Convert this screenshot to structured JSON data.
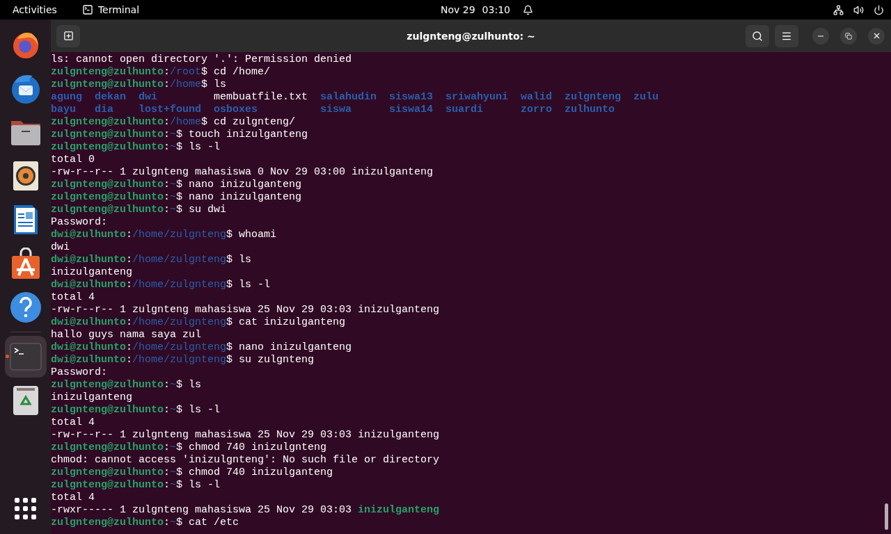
{
  "top_bar": {
    "activities": "Activities",
    "app": {
      "label": "Terminal"
    },
    "date": "Nov 29",
    "time": "03:10"
  },
  "dock": {
    "items": [
      {
        "kind": "browser",
        "selected": false,
        "running": false
      },
      {
        "kind": "mail",
        "selected": false,
        "running": false
      },
      {
        "kind": "folder",
        "selected": false,
        "running": false
      },
      {
        "kind": "speaker",
        "selected": false,
        "running": false
      },
      {
        "kind": "document",
        "selected": false,
        "running": false
      },
      {
        "kind": "store",
        "selected": false,
        "running": false
      },
      {
        "kind": "help",
        "selected": false,
        "running": false
      },
      {
        "kind": "terminal",
        "selected": true,
        "running": true
      },
      {
        "kind": "trash",
        "selected": false,
        "running": false
      }
    ]
  },
  "window": {
    "title": "zulgnteng@zulhunto: ~"
  },
  "terminal": {
    "lines": [
      [
        {
          "kind": "plain",
          "text": "ls: cannot open directory '.': Permission denied"
        }
      ],
      [
        {
          "kind": "user",
          "text": "zulgnteng@zulhunto"
        },
        {
          "kind": "plain",
          "text": ":"
        },
        {
          "kind": "path",
          "text": "/root"
        },
        {
          "kind": "plain",
          "text": "$ cd /home/"
        }
      ],
      [
        {
          "kind": "user",
          "text": "zulgnteng@zulhunto"
        },
        {
          "kind": "plain",
          "text": ":"
        },
        {
          "kind": "path",
          "text": "/home"
        },
        {
          "kind": "plain",
          "text": "$ ls"
        }
      ],
      {
        "kind": "listing",
        "rows": [
          [
            {
              "kind": "dir",
              "text": "agung"
            },
            {
              "kind": "dir",
              "text": "dekan"
            },
            {
              "kind": "dir",
              "text": "dwi"
            },
            {
              "kind": "plain",
              "text": "membuatfile.txt"
            },
            {
              "kind": "dir",
              "text": "salahudin"
            },
            {
              "kind": "dir",
              "text": "siswa13"
            },
            {
              "kind": "dir",
              "text": "sriwahyuni"
            },
            {
              "kind": "dir",
              "text": "walid"
            },
            {
              "kind": "dir",
              "text": "zulgnteng"
            },
            {
              "kind": "dir",
              "text": "zulu"
            }
          ],
          [
            {
              "kind": "dir",
              "text": "bayu"
            },
            {
              "kind": "dir",
              "text": "dia"
            },
            {
              "kind": "dir",
              "text": "lost+found"
            },
            {
              "kind": "dir",
              "text": "osboxes"
            },
            {
              "kind": "dir",
              "text": "siswa"
            },
            {
              "kind": "dir",
              "text": "siswa14"
            },
            {
              "kind": "dir",
              "text": "suardi"
            },
            {
              "kind": "dir",
              "text": "zorro"
            },
            {
              "kind": "dir",
              "text": "zulhunto"
            }
          ]
        ]
      },
      [
        {
          "kind": "user",
          "text": "zulgnteng@zulhunto"
        },
        {
          "kind": "plain",
          "text": ":"
        },
        {
          "kind": "path",
          "text": "/home"
        },
        {
          "kind": "plain",
          "text": "$ cd zulgnteng/"
        }
      ],
      [
        {
          "kind": "user",
          "text": "zulgnteng@zulhunto"
        },
        {
          "kind": "plain",
          "text": ":"
        },
        {
          "kind": "path",
          "text": "~"
        },
        {
          "kind": "plain",
          "text": "$ touch inizulganteng"
        }
      ],
      [
        {
          "kind": "user",
          "text": "zulgnteng@zulhunto"
        },
        {
          "kind": "plain",
          "text": ":"
        },
        {
          "kind": "path",
          "text": "~"
        },
        {
          "kind": "plain",
          "text": "$ ls -l"
        }
      ],
      [
        {
          "kind": "plain",
          "text": "total 0"
        }
      ],
      [
        {
          "kind": "plain",
          "text": "-rw-r--r-- 1 zulgnteng mahasiswa 0 Nov 29 03:00 inizulganteng"
        }
      ],
      [
        {
          "kind": "user",
          "text": "zulgnteng@zulhunto"
        },
        {
          "kind": "plain",
          "text": ":"
        },
        {
          "kind": "path",
          "text": "~"
        },
        {
          "kind": "plain",
          "text": "$ nano inizulganteng"
        }
      ],
      [
        {
          "kind": "user",
          "text": "zulgnteng@zulhunto"
        },
        {
          "kind": "plain",
          "text": ":"
        },
        {
          "kind": "path",
          "text": "~"
        },
        {
          "kind": "plain",
          "text": "$ nano inizulganteng"
        }
      ],
      [
        {
          "kind": "user",
          "text": "zulgnteng@zulhunto"
        },
        {
          "kind": "plain",
          "text": ":"
        },
        {
          "kind": "path",
          "text": "~"
        },
        {
          "kind": "plain",
          "text": "$ su dwi"
        }
      ],
      [
        {
          "kind": "plain",
          "text": "Password:"
        }
      ],
      [
        {
          "kind": "user",
          "text": "dwi@zulhunto"
        },
        {
          "kind": "plain",
          "text": ":"
        },
        {
          "kind": "path",
          "text": "/home/zulgnteng"
        },
        {
          "kind": "plain",
          "text": "$ whoami"
        }
      ],
      [
        {
          "kind": "plain",
          "text": "dwi"
        }
      ],
      [
        {
          "kind": "user",
          "text": "dwi@zulhunto"
        },
        {
          "kind": "plain",
          "text": ":"
        },
        {
          "kind": "path",
          "text": "/home/zulgnteng"
        },
        {
          "kind": "plain",
          "text": "$ ls"
        }
      ],
      [
        {
          "kind": "plain",
          "text": "inizulganteng"
        }
      ],
      [
        {
          "kind": "user",
          "text": "dwi@zulhunto"
        },
        {
          "kind": "plain",
          "text": ":"
        },
        {
          "kind": "path",
          "text": "/home/zulgnteng"
        },
        {
          "kind": "plain",
          "text": "$ ls -l"
        }
      ],
      [
        {
          "kind": "plain",
          "text": "total 4"
        }
      ],
      [
        {
          "kind": "plain",
          "text": "-rw-r--r-- 1 zulgnteng mahasiswa 25 Nov 29 03:03 inizulganteng"
        }
      ],
      [
        {
          "kind": "user",
          "text": "dwi@zulhunto"
        },
        {
          "kind": "plain",
          "text": ":"
        },
        {
          "kind": "path",
          "text": "/home/zulgnteng"
        },
        {
          "kind": "plain",
          "text": "$ cat inizulganteng"
        }
      ],
      [
        {
          "kind": "plain",
          "text": "hallo guys nama saya zul"
        }
      ],
      [
        {
          "kind": "user",
          "text": "dwi@zulhunto"
        },
        {
          "kind": "plain",
          "text": ":"
        },
        {
          "kind": "path",
          "text": "/home/zulgnteng"
        },
        {
          "kind": "plain",
          "text": "$ nano inizulganteng"
        }
      ],
      [
        {
          "kind": "user",
          "text": "dwi@zulhunto"
        },
        {
          "kind": "plain",
          "text": ":"
        },
        {
          "kind": "path",
          "text": "/home/zulgnteng"
        },
        {
          "kind": "plain",
          "text": "$ su zulgnteng"
        }
      ],
      [
        {
          "kind": "plain",
          "text": "Password:"
        }
      ],
      [
        {
          "kind": "user",
          "text": "zulgnteng@zulhunto"
        },
        {
          "kind": "plain",
          "text": ":"
        },
        {
          "kind": "path",
          "text": "~"
        },
        {
          "kind": "plain",
          "text": "$ ls"
        }
      ],
      [
        {
          "kind": "plain",
          "text": "inizulganteng"
        }
      ],
      [
        {
          "kind": "user",
          "text": "zulgnteng@zulhunto"
        },
        {
          "kind": "plain",
          "text": ":"
        },
        {
          "kind": "path",
          "text": "~"
        },
        {
          "kind": "plain",
          "text": "$ ls -l"
        }
      ],
      [
        {
          "kind": "plain",
          "text": "total 4"
        }
      ],
      [
        {
          "kind": "plain",
          "text": "-rw-r--r-- 1 zulgnteng mahasiswa 25 Nov 29 03:03 inizulganteng"
        }
      ],
      [
        {
          "kind": "user",
          "text": "zulgnteng@zulhunto"
        },
        {
          "kind": "plain",
          "text": ":"
        },
        {
          "kind": "path",
          "text": "~"
        },
        {
          "kind": "plain",
          "text": "$ chmod 740 inizulgnteng"
        }
      ],
      [
        {
          "kind": "plain",
          "text": "chmod: cannot access 'inizulgnteng': No such file or directory"
        }
      ],
      [
        {
          "kind": "user",
          "text": "zulgnteng@zulhunto"
        },
        {
          "kind": "plain",
          "text": ":"
        },
        {
          "kind": "path",
          "text": "~"
        },
        {
          "kind": "plain",
          "text": "$ chmod 740 inizulganteng"
        }
      ],
      [
        {
          "kind": "user",
          "text": "zulgnteng@zulhunto"
        },
        {
          "kind": "plain",
          "text": ":"
        },
        {
          "kind": "path",
          "text": "~"
        },
        {
          "kind": "plain",
          "text": "$ ls -l"
        }
      ],
      [
        {
          "kind": "plain",
          "text": "total 4"
        }
      ],
      [
        {
          "kind": "plain",
          "text": "-rwxr----- 1 zulgnteng mahasiswa 25 Nov 29 03:03 "
        },
        {
          "kind": "exec",
          "text": "inizulganteng"
        }
      ],
      [
        {
          "kind": "user",
          "text": "zulgnteng@zulhunto"
        },
        {
          "kind": "plain",
          "text": ":"
        },
        {
          "kind": "path",
          "text": "~"
        },
        {
          "kind": "plain",
          "text": "$ cat /etc"
        }
      ]
    ]
  }
}
